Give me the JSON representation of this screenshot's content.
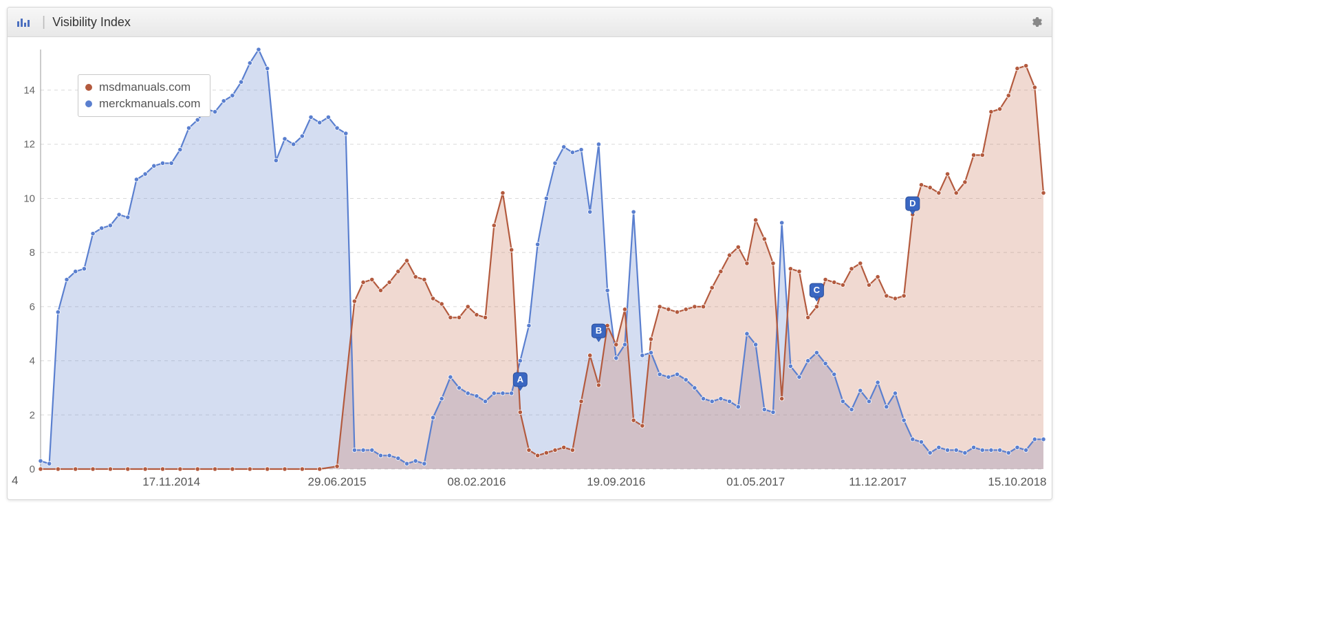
{
  "header": {
    "title": "Visibility Index"
  },
  "legend": {
    "series1_label": "msdmanuals.com",
    "series2_label": "merckmanuals.com"
  },
  "colors": {
    "series1": "#b35a3e",
    "series1_fill": "rgba(200,120,90,0.28)",
    "series2": "#5a7fcf",
    "series2_fill": "rgba(120,150,210,0.32)",
    "grid": "#d8d8d8",
    "axis": "#999"
  },
  "chart_data": {
    "type": "line",
    "title": "Visibility Index",
    "xlabel": "",
    "ylabel": "",
    "ylim": [
      0,
      15.5
    ],
    "x_axis_left_label": "4",
    "x_ticks": [
      "17.11.2014",
      "29.06.2015",
      "08.02.2016",
      "19.09.2016",
      "01.05.2017",
      "11.12.2017",
      "15.10.2018"
    ],
    "y_ticks": [
      0,
      2,
      4,
      6,
      8,
      10,
      12,
      14
    ],
    "markers": [
      {
        "label": "A",
        "x": 55
      },
      {
        "label": "B",
        "x": 64
      },
      {
        "label": "C",
        "x": 89
      },
      {
        "label": "D",
        "x": 100
      }
    ],
    "series": [
      {
        "name": "msdmanuals.com",
        "x": [
          0,
          2,
          4,
          6,
          8,
          10,
          12,
          14,
          16,
          18,
          20,
          22,
          24,
          26,
          28,
          30,
          32,
          34,
          36,
          37,
          38,
          39,
          40,
          41,
          42,
          43,
          44,
          45,
          46,
          47,
          48,
          49,
          50,
          51,
          52,
          53,
          54,
          55,
          56,
          57,
          58,
          59,
          60,
          61,
          62,
          63,
          64,
          65,
          66,
          67,
          68,
          69,
          70,
          71,
          72,
          73,
          74,
          75,
          76,
          77,
          78,
          79,
          80,
          81,
          82,
          83,
          84,
          85,
          86,
          87,
          88,
          89,
          90,
          91,
          92,
          93,
          94,
          95,
          96,
          97,
          98,
          99,
          100,
          101,
          102,
          103,
          104,
          105,
          106,
          107,
          108,
          109,
          110,
          111,
          112,
          113,
          114,
          115
        ],
        "y": [
          0,
          0,
          0,
          0,
          0,
          0,
          0,
          0,
          0,
          0,
          0,
          0,
          0,
          0,
          0,
          0,
          0,
          0.1,
          6.2,
          6.9,
          7.0,
          6.6,
          6.9,
          7.3,
          7.7,
          7.1,
          7.0,
          6.3,
          6.1,
          5.6,
          5.6,
          6.0,
          5.7,
          5.6,
          9.0,
          10.2,
          8.1,
          2.1,
          0.7,
          0.5,
          0.6,
          0.7,
          0.8,
          0.7,
          2.5,
          4.2,
          3.1,
          5.3,
          4.6,
          5.9,
          1.8,
          1.6,
          4.8,
          6.0,
          5.9,
          5.8,
          5.9,
          6.0,
          6.0,
          6.7,
          7.3,
          7.9,
          8.2,
          7.6,
          9.2,
          8.5,
          7.6,
          2.6,
          7.4,
          7.3,
          5.6,
          6.0,
          7.0,
          6.9,
          6.8,
          7.4,
          7.6,
          6.8,
          7.1,
          6.4,
          6.3,
          6.4,
          9.4,
          10.5,
          10.4,
          10.2,
          10.9,
          10.2,
          10.6,
          11.6,
          11.6,
          13.2,
          13.3,
          13.8,
          14.8,
          14.9,
          14.1,
          10.2
        ]
      },
      {
        "name": "merckmanuals.com",
        "x": [
          0,
          1,
          2,
          3,
          4,
          5,
          6,
          7,
          8,
          9,
          10,
          11,
          12,
          13,
          14,
          15,
          16,
          17,
          18,
          19,
          20,
          21,
          22,
          23,
          24,
          25,
          26,
          27,
          28,
          29,
          30,
          31,
          32,
          33,
          34,
          35,
          36,
          37,
          38,
          39,
          40,
          41,
          42,
          43,
          44,
          45,
          46,
          47,
          48,
          49,
          50,
          51,
          52,
          53,
          54,
          55,
          56,
          57,
          58,
          59,
          60,
          61,
          62,
          63,
          64,
          65,
          66,
          67,
          68,
          69,
          70,
          71,
          72,
          73,
          74,
          75,
          76,
          77,
          78,
          79,
          80,
          81,
          82,
          83,
          84,
          85,
          86,
          87,
          88,
          89,
          90,
          91,
          92,
          93,
          94,
          95,
          96,
          97,
          98,
          99,
          100,
          101,
          102,
          103,
          104,
          105,
          106,
          107,
          108,
          109,
          110,
          111,
          112,
          113,
          114,
          115
        ],
        "y": [
          0.3,
          0.2,
          5.8,
          7.0,
          7.3,
          7.4,
          8.7,
          8.9,
          9.0,
          9.4,
          9.3,
          10.7,
          10.9,
          11.2,
          11.3,
          11.3,
          11.8,
          12.6,
          12.9,
          13.3,
          13.2,
          13.6,
          13.8,
          14.3,
          15.0,
          15.5,
          14.8,
          11.4,
          12.2,
          12.0,
          12.3,
          13.0,
          12.8,
          13.0,
          12.6,
          12.4,
          0.7,
          0.7,
          0.7,
          0.5,
          0.5,
          0.4,
          0.2,
          0.3,
          0.2,
          1.9,
          2.6,
          3.4,
          3.0,
          2.8,
          2.7,
          2.5,
          2.8,
          2.8,
          2.8,
          4.0,
          5.3,
          8.3,
          10.0,
          11.3,
          11.9,
          11.7,
          11.8,
          9.5,
          12.0,
          6.6,
          4.1,
          4.6,
          9.5,
          4.2,
          4.3,
          3.5,
          3.4,
          3.5,
          3.3,
          3.0,
          2.6,
          2.5,
          2.6,
          2.5,
          2.3,
          5.0,
          4.6,
          2.2,
          2.1,
          9.1,
          3.8,
          3.4,
          4.0,
          4.3,
          3.9,
          3.5,
          2.5,
          2.2,
          2.9,
          2.5,
          3.2,
          2.3,
          2.8,
          1.8,
          1.1,
          1.0,
          0.6,
          0.8,
          0.7,
          0.7,
          0.6,
          0.8,
          0.7,
          0.7,
          0.7,
          0.6,
          0.8,
          0.7,
          1.1,
          1.1
        ]
      }
    ]
  }
}
